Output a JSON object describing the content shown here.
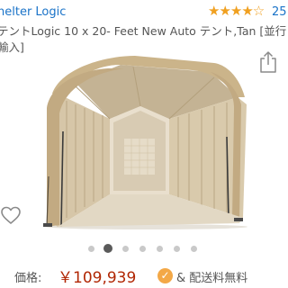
{
  "header": {
    "brand_link": "helter Logic",
    "rating_stars": "★★★★☆",
    "review_count": "25"
  },
  "product": {
    "title_line1": "テントLogic 10 x 20- Feet New Auto テント,Tan [並行",
    "title_line2": "輸入]",
    "image_subject": "tan-auto-tent"
  },
  "gallery": {
    "dot_count": 7,
    "active_index": 1
  },
  "purchase": {
    "price_label": "価格:",
    "price_value": "￥109,939",
    "badge_symbol": "✓",
    "shipping_text": "& 配送料無料"
  },
  "icons": {
    "share": "share-icon",
    "wishlist": "heart-outline-icon",
    "prime": "prime-check-icon"
  },
  "colors": {
    "link": "#1a73c8",
    "star": "#f0a020",
    "price": "#b12704",
    "badge": "#f3a847",
    "dot_active": "#5a5a5a",
    "dot_inactive": "#c9c9c9"
  }
}
